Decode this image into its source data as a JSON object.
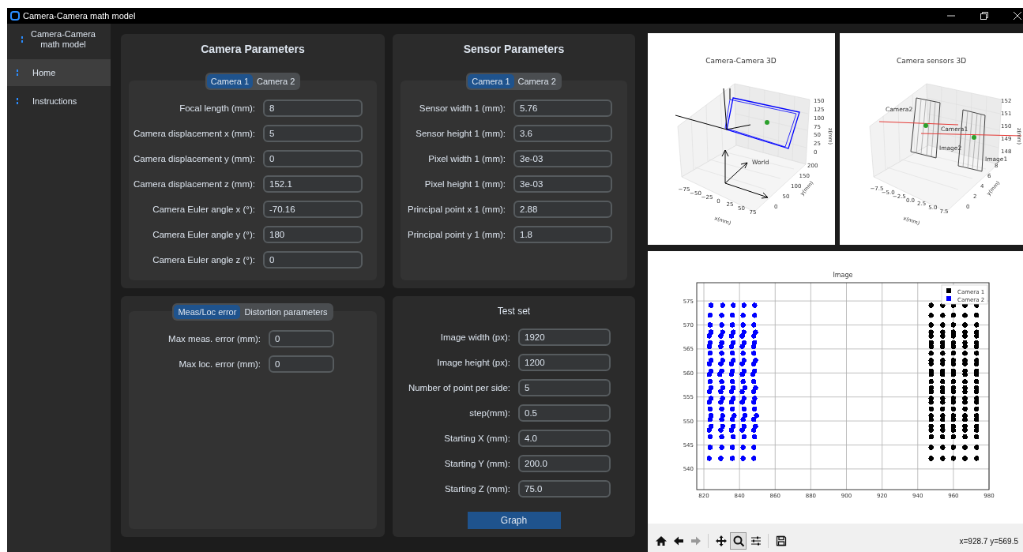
{
  "title_bar": {
    "title": "Camera-Camera math model"
  },
  "sidebar": {
    "app_name": "Camera-Camera math model",
    "items": [
      {
        "label": "Home",
        "selected": true
      },
      {
        "label": "Instructions",
        "selected": false
      }
    ]
  },
  "camera_parameters": {
    "title": "Camera Parameters",
    "tabs": [
      {
        "label": "Camera 1",
        "selected": true
      },
      {
        "label": "Camera 2",
        "selected": false
      }
    ],
    "fields": [
      {
        "label": "Focal length (mm):",
        "value": "8"
      },
      {
        "label": "Camera displacement x (mm):",
        "value": "5"
      },
      {
        "label": "Camera displacement y (mm):",
        "value": "0"
      },
      {
        "label": "Camera displacement z (mm):",
        "value": "152.1"
      },
      {
        "label": "Camera Euler angle x (°):",
        "value": "-70.16"
      },
      {
        "label": "Camera Euler angle y (°):",
        "value": "180"
      },
      {
        "label": "Camera Euler angle z (°):",
        "value": "0"
      }
    ]
  },
  "sensor_parameters": {
    "title": "Sensor Parameters",
    "tabs": [
      {
        "label": "Camera 1",
        "selected": true
      },
      {
        "label": "Camera 2",
        "selected": false
      }
    ],
    "fields": [
      {
        "label": "Sensor width 1 (mm):",
        "value": "5.76"
      },
      {
        "label": "Sensor height 1 (mm):",
        "value": "3.6"
      },
      {
        "label": "Pixel width 1 (mm):",
        "value": "3e-03"
      },
      {
        "label": "Pixel height 1 (mm):",
        "value": "3e-03"
      },
      {
        "label": "Principal point x 1 (mm):",
        "value": "2.88"
      },
      {
        "label": "Principal point y 1 (mm):",
        "value": "1.8"
      }
    ]
  },
  "error_settings": {
    "tabs": [
      {
        "label": "Meas/Loc error",
        "selected": true
      },
      {
        "label": "Distortion parameters",
        "selected": false
      }
    ],
    "fields": [
      {
        "label": "Max meas. error (mm):",
        "value": "0"
      },
      {
        "label": "Max loc. error (mm):",
        "value": "0"
      }
    ]
  },
  "test_set": {
    "title": "Test set",
    "fields": [
      {
        "label": "Image width (px):",
        "value": "1920"
      },
      {
        "label": "Image height (px):",
        "value": "1200"
      },
      {
        "label": "Number of point per side:",
        "value": "5"
      },
      {
        "label": "step(mm):",
        "value": "0.5"
      },
      {
        "label": "Starting X (mm):",
        "value": "4.0"
      },
      {
        "label": "Starting Y (mm):",
        "value": "200.0"
      },
      {
        "label": "Starting Z (mm):",
        "value": "75.0"
      }
    ],
    "button": "Graph"
  },
  "plots_3d": [
    {
      "kind": "cameras",
      "title": "Camera-Camera 3D",
      "xlabel": "x(mm)",
      "ylabel": "y(mm)",
      "zlabel": "z(mm)",
      "xticks": [
        "−75",
        "−50",
        "−25",
        "0",
        "25",
        "50",
        "75"
      ],
      "yticks": [
        "0",
        "50",
        "100",
        "150",
        "200"
      ],
      "zticks": [
        "150",
        "125",
        "100",
        "75",
        "50",
        "25",
        "0"
      ],
      "labels": [
        "World"
      ]
    },
    {
      "kind": "sensors",
      "title": "Camera sensors 3D",
      "xlabel": "x(mm)",
      "ylabel": "y(mm)",
      "zlabel": "z(mm)",
      "xticks": [
        "−7.5",
        "−5.0",
        "−2.5",
        "0.0",
        "2.5",
        "5.0",
        "7.5"
      ],
      "yticks": [
        "0",
        "2",
        "4",
        "6",
        "8"
      ],
      "zticks": [
        "152",
        "151",
        "150",
        "149",
        "148"
      ],
      "labels": [
        "Camera2",
        "Camera1",
        "Image2",
        "Image1"
      ]
    }
  ],
  "image_plot": {
    "chart_data": {
      "type": "scatter",
      "title": "Image",
      "grid": true,
      "legend": "upper right",
      "xlim": [
        816,
        980
      ],
      "ylim": [
        535.7,
        578.8
      ],
      "xticks": [
        820,
        840,
        860,
        880,
        900,
        920,
        940,
        960,
        980
      ],
      "yticks": [
        540,
        545,
        550,
        555,
        560,
        565,
        570,
        575
      ],
      "series": [
        {
          "name": "Camera 1",
          "color": "#000000",
          "x": [
            947.5,
            954,
            960,
            966.5,
            973,
            947.5,
            954,
            960,
            966.5,
            973,
            947.5,
            954,
            960,
            966.5,
            973,
            947.5,
            954,
            960,
            966.5,
            973,
            947.5,
            954,
            960,
            966.5,
            973,
            947.5,
            954,
            960,
            966.5,
            973,
            947.5,
            954,
            960,
            966.5,
            973,
            947.5,
            954,
            960,
            966.5,
            973,
            947.5,
            954,
            960,
            966.5,
            973,
            947.5,
            954,
            960,
            966.5,
            973,
            947.5,
            954,
            960,
            966.5,
            973,
            947.5,
            954,
            960,
            966.5,
            973,
            947.5,
            954,
            960,
            966.5,
            973,
            947.5,
            954,
            960,
            966.5,
            973,
            947.5,
            954,
            960,
            966.5,
            973,
            947.5,
            954,
            960,
            966.5,
            973,
            947.5,
            954,
            960,
            966.5,
            973,
            947.5,
            954,
            960,
            966.5,
            973,
            947.5,
            954,
            960,
            966.5,
            973,
            947.5,
            954,
            960,
            966.5,
            973,
            947.5,
            954,
            960,
            966.5,
            973,
            947.5,
            954,
            960,
            966.5,
            973,
            947.5,
            954,
            960,
            966.5,
            973,
            947.5,
            954,
            960,
            966.5,
            973,
            947.5,
            954,
            960,
            966.5,
            973
          ],
          "values": [
            574.1,
            574.1,
            574.1,
            574.1,
            574.1,
            572,
            572,
            572,
            572,
            572,
            570,
            570,
            570,
            570,
            570,
            568.5,
            568.5,
            568.5,
            568.5,
            568.5,
            567.7,
            567.7,
            567.7,
            567.7,
            567.7,
            566.3,
            566.3,
            566.3,
            566.3,
            566.3,
            565.5,
            565.5,
            565.5,
            565.5,
            565.5,
            564.1,
            564.1,
            564.1,
            564.1,
            564.1,
            562.6,
            562.6,
            562.6,
            562.6,
            562.6,
            561.9,
            561.9,
            561.9,
            561.9,
            561.9,
            560.4,
            560.4,
            560.4,
            560.4,
            560.4,
            559.7,
            559.7,
            559.7,
            559.7,
            559.7,
            558.2,
            558.2,
            558.2,
            558.2,
            558.2,
            556.9,
            556.9,
            556.9,
            556.9,
            556.9,
            556.1,
            556.1,
            556.1,
            556.1,
            556.1,
            554.7,
            554.7,
            554.7,
            554.7,
            554.7,
            553.9,
            553.9,
            553.9,
            553.9,
            553.9,
            552.5,
            552.5,
            552.5,
            552.5,
            552.5,
            551.1,
            551.1,
            551.1,
            551.1,
            551.1,
            550.3,
            550.3,
            550.3,
            550.3,
            550.3,
            548.9,
            548.9,
            548.9,
            548.9,
            548.9,
            548.1,
            548.1,
            548.1,
            548.1,
            548.1,
            546.7,
            546.7,
            546.7,
            546.7,
            546.7,
            544.5,
            544.5,
            544.5,
            544.5,
            544.5,
            542.2,
            542.2,
            542.2,
            542.2,
            542.2
          ]
        },
        {
          "name": "Camera 2",
          "color": "#0000ff",
          "x": [
            824,
            830.5,
            836.5,
            842.5,
            848.5,
            823.5,
            830,
            836,
            842,
            848.5,
            823.5,
            830,
            836,
            842,
            848,
            824,
            830.5,
            836.5,
            842.5,
            849,
            823,
            829.5,
            835.5,
            841.5,
            848,
            823.5,
            830,
            836.5,
            842.5,
            848.5,
            823,
            829.5,
            835.5,
            841.5,
            848,
            823.5,
            830,
            836,
            842,
            848,
            824,
            830.5,
            836.5,
            842.5,
            849,
            823,
            829.5,
            835.5,
            841.5,
            848,
            824,
            830,
            836,
            842.5,
            848.5,
            823,
            829,
            835.5,
            841.5,
            847.5,
            823.5,
            830,
            836,
            842,
            848,
            824,
            830.5,
            836.5,
            843,
            849,
            823,
            829.5,
            835.5,
            841.5,
            848,
            824,
            830.5,
            836.5,
            842.5,
            848.5,
            823,
            829.5,
            835.5,
            841.5,
            848,
            823.5,
            830,
            836,
            842.5,
            848.5,
            824,
            830.5,
            837,
            843,
            849.5,
            823.5,
            830,
            836,
            842,
            848,
            824,
            830.5,
            836.5,
            842.5,
            849,
            823,
            829.5,
            835.5,
            841.5,
            848,
            823.5,
            830,
            836.5,
            842.5,
            848.5,
            823.5,
            830,
            836,
            842,
            848,
            823,
            829.5,
            836,
            842,
            848
          ],
          "values": [
            574.1,
            574.1,
            574.1,
            574.1,
            574.1,
            572,
            572,
            572,
            572,
            572,
            570,
            570,
            570,
            570,
            570,
            568.5,
            568.5,
            568.5,
            568.5,
            568.5,
            567.7,
            567.7,
            567.7,
            567.7,
            567.7,
            566.3,
            566.3,
            566.3,
            566.3,
            566.3,
            565.5,
            565.5,
            565.5,
            565.5,
            565.5,
            564.1,
            564.1,
            564.1,
            564.1,
            564.1,
            562.6,
            562.6,
            562.6,
            562.6,
            562.6,
            561.9,
            561.9,
            561.9,
            561.9,
            561.9,
            560.4,
            560.4,
            560.4,
            560.4,
            560.4,
            559.7,
            559.7,
            559.7,
            559.7,
            559.7,
            558.2,
            558.2,
            558.2,
            558.2,
            558.2,
            556.9,
            556.9,
            556.9,
            556.9,
            556.9,
            556.1,
            556.1,
            556.1,
            556.1,
            556.1,
            554.7,
            554.7,
            554.7,
            554.7,
            554.7,
            553.9,
            553.9,
            553.9,
            553.9,
            553.9,
            552.5,
            552.5,
            552.5,
            552.5,
            552.5,
            551.1,
            551.1,
            551.1,
            551.1,
            551.1,
            550.3,
            550.3,
            550.3,
            550.3,
            550.3,
            548.9,
            548.9,
            548.9,
            548.9,
            548.9,
            548.1,
            548.1,
            548.1,
            548.1,
            548.1,
            546.7,
            546.7,
            546.7,
            546.7,
            546.7,
            544.5,
            544.5,
            544.5,
            544.5,
            544.5,
            542.2,
            542.2,
            542.2,
            542.2,
            542.2
          ]
        }
      ]
    }
  },
  "toolbar": {
    "tools": [
      {
        "kind": "home",
        "selected": false,
        "disabled": false
      },
      {
        "kind": "back",
        "selected": false,
        "disabled": false
      },
      {
        "kind": "forward",
        "selected": false,
        "disabled": true
      },
      {
        "kind": "pan",
        "selected": false,
        "disabled": false
      },
      {
        "kind": "zoom",
        "selected": true,
        "disabled": false
      },
      {
        "kind": "configure",
        "selected": false,
        "disabled": false
      },
      {
        "kind": "save",
        "selected": false,
        "disabled": false
      }
    ],
    "coordinates": "x=928.7 y=569.5"
  }
}
